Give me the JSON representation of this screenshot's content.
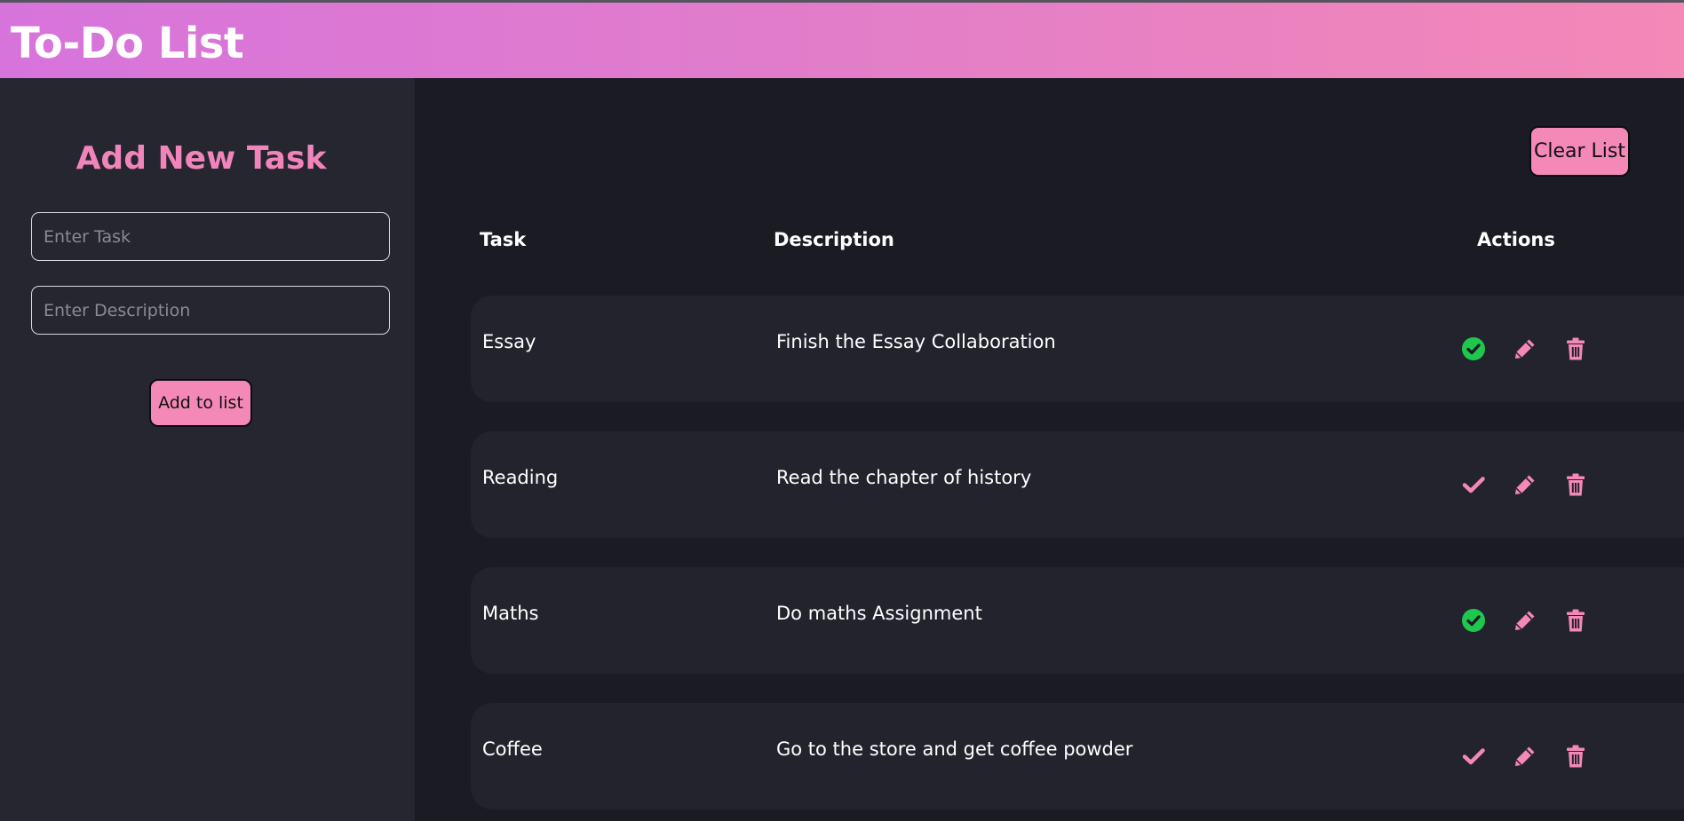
{
  "header": {
    "title": "To-Do List"
  },
  "sidebar": {
    "title": "Add New Task",
    "task_placeholder": "Enter Task",
    "description_placeholder": "Enter Description",
    "add_button": "Add to list"
  },
  "main": {
    "clear_button": "Clear List",
    "columns": [
      "Task",
      "Description",
      "Actions"
    ],
    "rows": [
      {
        "task": "Essay",
        "description": "Finish the Essay Collaboration",
        "completed": true
      },
      {
        "task": "Reading",
        "description": "Read the chapter of history",
        "completed": false
      },
      {
        "task": "Maths",
        "description": "Do maths Assignment",
        "completed": true
      },
      {
        "task": "Coffee",
        "description": "Go to the store and get coffee powder",
        "completed": false
      }
    ]
  },
  "icons": [
    "check-circle-icon",
    "check-icon",
    "pencil-icon",
    "trash-icon"
  ],
  "colors": {
    "accent_pink": "#f488b7",
    "header_gradient_start": "#d774dc",
    "header_gradient_end": "#f488b7",
    "done_green": "#1ec84f",
    "background": "#1b1b23",
    "sidebar_bg": "#262630",
    "row_bg": "#23232d"
  }
}
